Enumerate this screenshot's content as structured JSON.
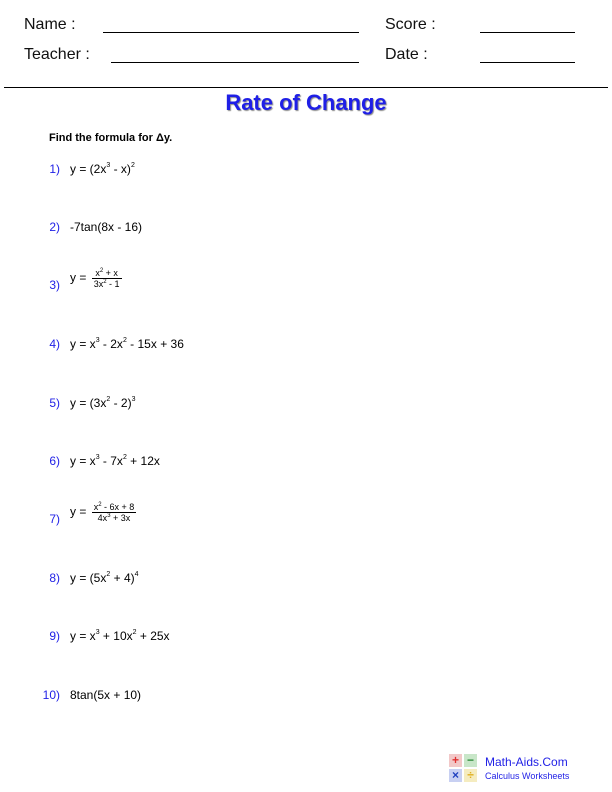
{
  "header": {
    "name_label": "Name :",
    "teacher_label": "Teacher :",
    "score_label": "Score :",
    "date_label": "Date :"
  },
  "title": "Rate of Change",
  "instructions": "Find the formula for Δy.",
  "problems": [
    {
      "num": "1)"
    },
    {
      "num": "2)",
      "text": "-7tan(8x - 16)"
    },
    {
      "num": "3)"
    },
    {
      "num": "4)"
    },
    {
      "num": "5)"
    },
    {
      "num": "6)"
    },
    {
      "num": "7)"
    },
    {
      "num": "8)"
    },
    {
      "num": "9)"
    },
    {
      "num": "10)",
      "text": "8tan(5x + 10)"
    }
  ],
  "expr": {
    "p1": {
      "a": "y = (2x",
      "e1": "3",
      "b": " - x)",
      "e2": "2"
    },
    "p3": {
      "lhs": "y = ",
      "n1": "x",
      "ne": "2",
      "n2": " + x",
      "d1": "3x",
      "de": "2",
      "d2": " - 1"
    },
    "p4": {
      "a": "y = x",
      "e1": "3",
      "b": " - 2x",
      "e2": "2",
      "c": " - 15x + 36"
    },
    "p5": {
      "a": "y = (3x",
      "e1": "2",
      "b": " - 2)",
      "e2": "3"
    },
    "p6": {
      "a": "y = x",
      "e1": "3",
      "b": " - 7x",
      "e2": "2",
      "c": " + 12x"
    },
    "p7": {
      "lhs": "y = ",
      "n1": "x",
      "ne": "2",
      "n2": " - 6x + 8",
      "d1": "4x",
      "de": "3",
      "d2": " + 3x"
    },
    "p8": {
      "a": "y = (5x",
      "e1": "2",
      "b": " + 4)",
      "e2": "4"
    },
    "p9": {
      "a": "y = x",
      "e1": "3",
      "b": " + 10x",
      "e2": "2",
      "c": " + 25x"
    }
  },
  "logo": {
    "title": "Math-Aids.Com",
    "subtitle": "Calculus Worksheets",
    "symbols": [
      "+",
      "−",
      "×",
      "÷"
    ],
    "colors": {
      "plus": "#e03030",
      "minus": "#2e8b3a",
      "times": "#1f3fbf",
      "divide": "#e0b020"
    }
  },
  "colors": {
    "accent": "#1f1fe6"
  }
}
